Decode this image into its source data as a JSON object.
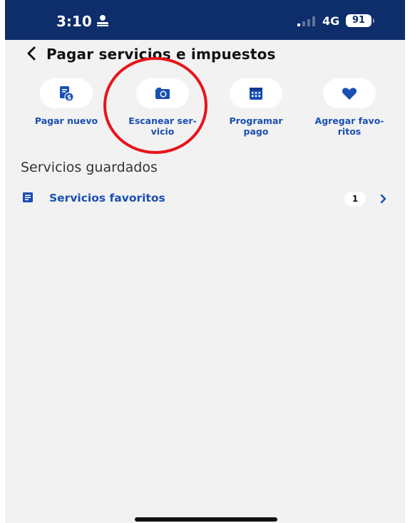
{
  "status_bar": {
    "time": "3:10",
    "network": "4G",
    "battery": "91",
    "icons": [
      "person-icon",
      "signal-icon"
    ]
  },
  "header": {
    "title": "Pagar servicios e impuestos",
    "back_icon": "chevron-left-icon"
  },
  "actions": [
    {
      "icon": "receipt-dollar-icon",
      "label_lines": [
        "Pagar nuevo"
      ]
    },
    {
      "icon": "camera-icon",
      "label_lines": [
        "Escanear ser-",
        "vicio"
      ]
    },
    {
      "icon": "calendar-icon",
      "label_lines": [
        "Programar",
        "pago"
      ]
    },
    {
      "icon": "heart-icon",
      "label_lines": [
        "Agregar favo-",
        "ritos"
      ]
    }
  ],
  "saved": {
    "section_title": "Servicios guardados",
    "favorites": {
      "label": "Servicios favoritos",
      "count": "1",
      "icon": "document-icon",
      "chevron": "chevron-right-icon"
    }
  },
  "colors": {
    "status_bar_bg": "#0d2d6b",
    "accent": "#1a4fb4",
    "background": "#f2f2f2",
    "annotation": "#e8141b"
  }
}
